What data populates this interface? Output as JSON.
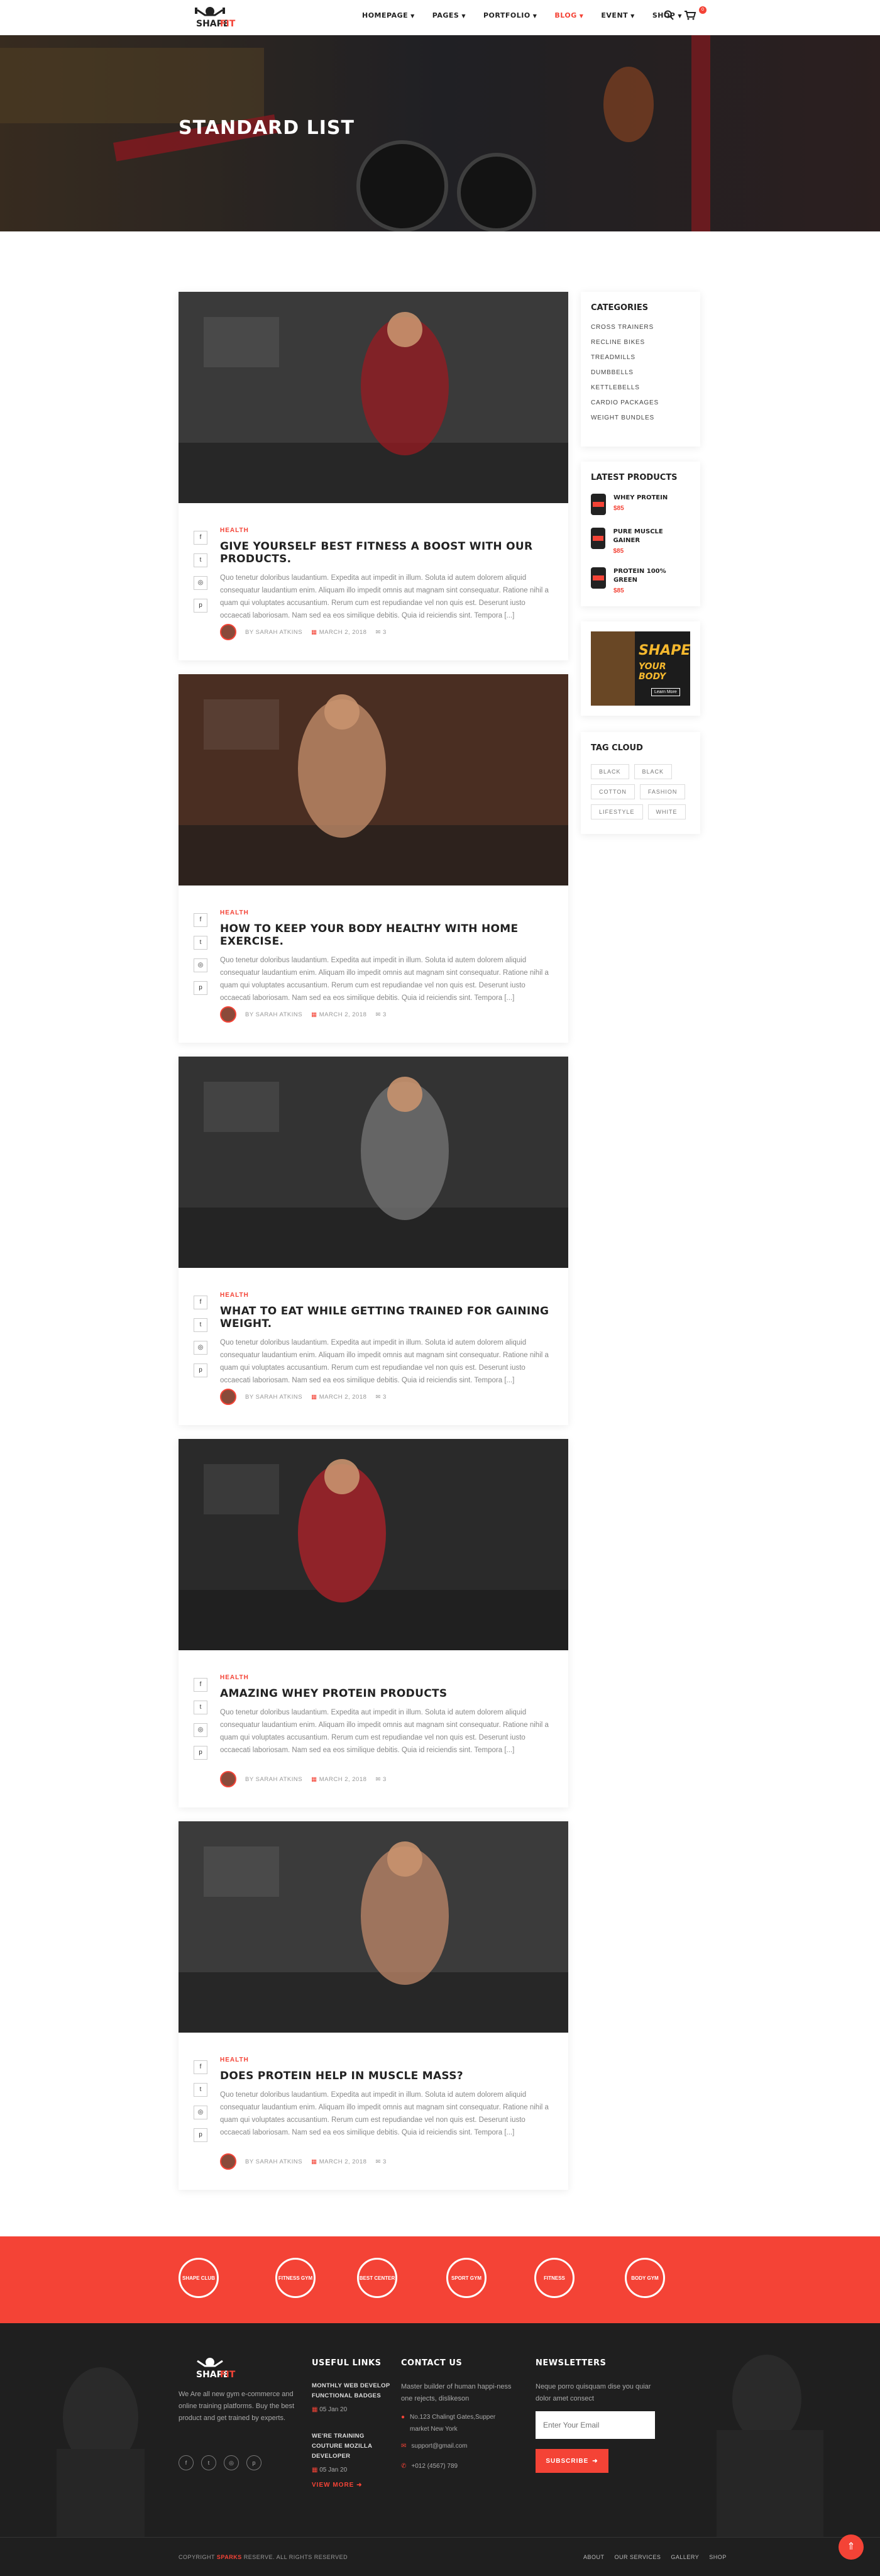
{
  "brand": {
    "name_top": "SHAPE",
    "name_bottom": "FIT",
    "accent": "#f44336"
  },
  "nav": [
    {
      "label": "HOMEPAGE",
      "active": false
    },
    {
      "label": "PAGES",
      "active": false
    },
    {
      "label": "PORTFOLIO",
      "active": false
    },
    {
      "label": "BLOG",
      "active": true
    },
    {
      "label": "EVENT",
      "active": false
    },
    {
      "label": "SHOP",
      "active": false
    }
  ],
  "cart_count": "0",
  "hero": {
    "title": "STANDARD LIST"
  },
  "posts": [
    {
      "category": "HEALTH",
      "title": "GIVE YOURSELF BEST FITNESS A BOOST WITH OUR PRODUCTS.",
      "excerpt": "Quo tenetur doloribus laudantium. Expedita aut impedit in illum. Soluta id autem dolorem aliquid consequatur laudantium enim. Aliquam illo impedit omnis aut magnam sint consequatur. Ratione nihil a quam qui voluptates accusantium. Rerum cum est repudiandae vel non quis est. Deserunt iusto occaecati laboriosam. Nam sed ea eos similique debitis. Quia id reiciendis sint. Tempora [...]",
      "author": "BY SARAH ATKINS",
      "date": "MARCH 2, 2018",
      "comments": "3"
    },
    {
      "category": "HEALTH",
      "title": "HOW TO KEEP YOUR BODY HEALTHY WITH HOME EXERCISE.",
      "excerpt": "Quo tenetur doloribus laudantium. Expedita aut impedit in illum. Soluta id autem dolorem aliquid consequatur laudantium enim. Aliquam illo impedit omnis aut magnam sint consequatur. Ratione nihil a quam qui voluptates accusantium. Rerum cum est repudiandae vel non quis est. Deserunt iusto occaecati laboriosam. Nam sed ea eos similique debitis. Quia id reiciendis sint. Tempora [...]",
      "author": "BY SARAH ATKINS",
      "date": "MARCH 2, 2018",
      "comments": "3"
    },
    {
      "category": "HEALTH",
      "title": "WHAT TO EAT WHILE GETTING TRAINED FOR GAINING WEIGHT.",
      "excerpt": "Quo tenetur doloribus laudantium. Expedita aut impedit in illum. Soluta id autem dolorem aliquid consequatur laudantium enim. Aliquam illo impedit omnis aut magnam sint consequatur. Ratione nihil a quam qui voluptates accusantium. Rerum cum est repudiandae vel non quis est. Deserunt iusto occaecati laboriosam. Nam sed ea eos similique debitis. Quia id reiciendis sint. Tempora [...]",
      "author": "BY SARAH ATKINS",
      "date": "MARCH 2, 2018",
      "comments": "3"
    },
    {
      "category": "HEALTH",
      "title": "AMAZING WHEY PROTEIN PRODUCTS",
      "excerpt": "Quo tenetur doloribus laudantium. Expedita aut impedit in illum. Soluta id autem dolorem aliquid consequatur laudantium enim. Aliquam illo impedit omnis aut magnam sint consequatur. Ratione nihil a quam qui voluptates accusantium. Rerum cum est repudiandae vel non quis est. Deserunt iusto occaecati laboriosam. Nam sed ea eos similique debitis. Quia id reiciendis sint. Tempora [...]",
      "author": "BY SARAH ATKINS",
      "date": "MARCH 2, 2018",
      "comments": "3"
    },
    {
      "category": "HEALTH",
      "title": "DOES PROTEIN HELP IN MUSCLE MASS?",
      "excerpt": "Quo tenetur doloribus laudantium. Expedita aut impedit in illum. Soluta id autem dolorem aliquid consequatur laudantium enim. Aliquam illo impedit omnis aut magnam sint consequatur. Ratione nihil a quam qui voluptates accusantium. Rerum cum est repudiandae vel non quis est. Deserunt iusto occaecati laboriosam. Nam sed ea eos similique debitis. Quia id reiciendis sint. Tempora [...]",
      "author": "BY SARAH ATKINS",
      "date": "MARCH 2, 2018",
      "comments": "3"
    }
  ],
  "sidebar": {
    "categories_title": "CATEGORIES",
    "categories": [
      "CROSS TRAINERS",
      "RECLINE BIKES",
      "TREADMILLS",
      "DUMBBELLS",
      "KETTLEBELLS",
      "CARDIO PACKAGES",
      "WEIGHT BUNDLES"
    ],
    "latest_title": "LATEST PRODUCTS",
    "products": [
      {
        "name": "WHEY PROTEIN",
        "price": "$85"
      },
      {
        "name": "PURE MUSCLE GAINER",
        "price": "$85"
      },
      {
        "name": "PROTEIN 100% GREEN",
        "price": "$85"
      }
    ],
    "banner": {
      "line1": "SHAPE",
      "line2": "YOUR BODY",
      "button": "Learn More"
    },
    "tags_title": "TAG CLOUD",
    "tags": [
      "BLACK",
      "BLACK",
      "COTTON",
      "FASHION",
      "LIFESTYLE",
      "WHITE"
    ]
  },
  "badges": [
    "SHAPE CLUB",
    "FITNESS GYM",
    "BEST CENTER",
    "SPORT GYM",
    "FITNESS",
    "BODY GYM"
  ],
  "footer": {
    "about": "We Are all new gym e-commerce and online training platforms. Buy the best product and get trained by experts.",
    "useful_title": "USEFUL LINKS",
    "links": [
      {
        "title": "MONTHLY WEB DEVELOP FUNCTIONAL BADGES",
        "date": "05 Jan 20"
      },
      {
        "title": "WE'RE TRAINING COUTURE MOZILLA DEVELOPER",
        "date": "05 Jan 20"
      }
    ],
    "view_more": "VIEW MORE",
    "contact_title": "CONTACT US",
    "contact_text": "Master builder of human happi-ness one rejects, dislikeson",
    "address": "No.123 Chalingt Gates,Supper market New York",
    "email": "support@gmail.com",
    "phone": "+012 (4567) 789",
    "news_title": "NEWSLETTERS",
    "news_text": "Neque porro quisquam dise you quiar dolor amet consect",
    "email_placeholder": "Enter Your Email",
    "subscribe": "SUBSCRIBE",
    "copyright_pre": "COPYRIGHT",
    "copyright_brand": "SPARKS",
    "copyright_post": "RESERVE. ALL RIGHTS RESERVED",
    "bottom_links": [
      "ABOUT",
      "OUR SERVICES",
      "GALLERY",
      "SHOP"
    ]
  }
}
